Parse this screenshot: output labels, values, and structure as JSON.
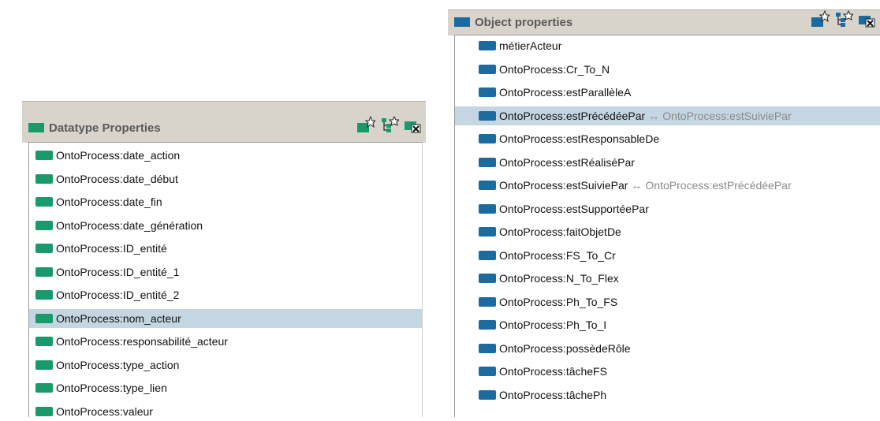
{
  "datatype_panel": {
    "title": "Datatype Properties",
    "header_color": "#1a9a6a",
    "tools": [
      "create-property-icon",
      "create-subproperty-icon",
      "delete-property-icon"
    ],
    "selected_index": 7,
    "items": [
      {
        "label": "OntoProcess:date_action"
      },
      {
        "label": "OntoProcess:date_début"
      },
      {
        "label": "OntoProcess:date_fin"
      },
      {
        "label": "OntoProcess:date_génération"
      },
      {
        "label": "OntoProcess:ID_entité"
      },
      {
        "label": "OntoProcess:ID_entité_1"
      },
      {
        "label": "OntoProcess:ID_entité_2"
      },
      {
        "label": "OntoProcess:nom_acteur"
      },
      {
        "label": "OntoProcess:responsabilité_acteur"
      },
      {
        "label": "OntoProcess:type_action"
      },
      {
        "label": "OntoProcess:type_lien"
      },
      {
        "label": "OntoProcess:valeur"
      }
    ]
  },
  "object_panel": {
    "title": "Object properties",
    "header_color": "#1b6aa0",
    "tools": [
      "create-property-icon",
      "create-subproperty-icon",
      "delete-property-icon"
    ],
    "selected_index": 3,
    "items": [
      {
        "label": "métierActeur",
        "inverse": ""
      },
      {
        "label": "OntoProcess:Cr_To_N",
        "inverse": ""
      },
      {
        "label": "OntoProcess:estParallèleA",
        "inverse": ""
      },
      {
        "label": "OntoProcess:estPrécédéePar",
        "inverse": "OntoProcess:estSuiviePar"
      },
      {
        "label": "OntoProcess:estResponsableDe",
        "inverse": ""
      },
      {
        "label": "OntoProcess:estRéaliséPar",
        "inverse": ""
      },
      {
        "label": "OntoProcess:estSuiviePar",
        "inverse": "OntoProcess:estPrécédéePar"
      },
      {
        "label": "OntoProcess:estSupportéePar",
        "inverse": ""
      },
      {
        "label": "OntoProcess:faitObjetDe",
        "inverse": ""
      },
      {
        "label": "OntoProcess:FS_To_Cr",
        "inverse": ""
      },
      {
        "label": "OntoProcess:N_To_Flex",
        "inverse": ""
      },
      {
        "label": "OntoProcess:Ph_To_FS",
        "inverse": ""
      },
      {
        "label": "OntoProcess:Ph_To_I",
        "inverse": ""
      },
      {
        "label": "OntoProcess:possèdeRôle",
        "inverse": ""
      },
      {
        "label": "OntoProcess:tâcheFS",
        "inverse": ""
      },
      {
        "label": "OntoProcess:tâchePh",
        "inverse": ""
      }
    ]
  },
  "inverse_arrow": "↔"
}
